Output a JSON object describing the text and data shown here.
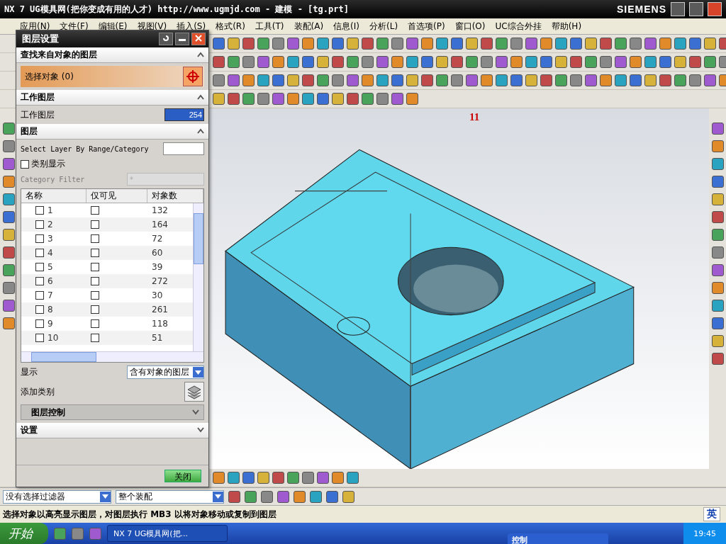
{
  "window": {
    "title": "NX 7 UG模具网(把你变成有用的人才) http://www.ugmjd.com - 建模 - [tg.prt]",
    "brand": "SIEMENS"
  },
  "menu": [
    "应用(N)",
    "文件(F)",
    "编辑(E)",
    "视图(V)",
    "插入(S)",
    "格式(R)",
    "工具(T)",
    "装配(A)",
    "信息(I)",
    "分析(L)",
    "首选项(P)",
    "窗口(O)",
    "UC综合外挂",
    "帮助(H)"
  ],
  "viewport": {
    "label": "11"
  },
  "dialog": {
    "title": "图层设置",
    "find_section": {
      "title": "查找来自对象的图层",
      "expanded": true,
      "select_label": "选择对象 (0)"
    },
    "work_section": {
      "title": "工作图层",
      "expanded": true,
      "label": "工作图层",
      "value": "254"
    },
    "layers_section": {
      "title": "图层",
      "expanded": true,
      "range_label": "Select Layer By Range/Category",
      "category_display": {
        "label": "类别显示",
        "checked": false
      },
      "category_filter": {
        "label": "Category Filter",
        "value": "*",
        "disabled": true
      },
      "columns": [
        "名称",
        "仅可见",
        "对象数"
      ],
      "rows": [
        {
          "name": "1",
          "checked": false,
          "visible_only": false,
          "count": "132"
        },
        {
          "name": "2",
          "checked": false,
          "visible_only": false,
          "count": "164"
        },
        {
          "name": "3",
          "checked": false,
          "visible_only": false,
          "count": "72"
        },
        {
          "name": "4",
          "checked": false,
          "visible_only": false,
          "count": "60"
        },
        {
          "name": "5",
          "checked": false,
          "visible_only": false,
          "count": "39"
        },
        {
          "name": "6",
          "checked": false,
          "visible_only": false,
          "count": "272"
        },
        {
          "name": "7",
          "checked": false,
          "visible_only": false,
          "count": "30"
        },
        {
          "name": "8",
          "checked": false,
          "visible_only": false,
          "count": "261"
        },
        {
          "name": "9",
          "checked": false,
          "visible_only": false,
          "count": "118"
        },
        {
          "name": "10",
          "checked": false,
          "visible_only": false,
          "count": "51"
        }
      ],
      "show_label": "显示",
      "show_value": "含有对象的图层",
      "add_category_label": "添加类别",
      "control": {
        "title": "图层控制",
        "expanded": false
      }
    },
    "settings_section": {
      "title": "设置",
      "expanded": false
    },
    "close_button": "关闭"
  },
  "filters": [
    "没有选择过滤器",
    "整个装配"
  ],
  "status_text": "选择对象以高亮显示图层，对图层执行 MB3 以将对象移动或复制到图层",
  "ime": "英",
  "taskbar": {
    "start": "开始",
    "tasks": [
      {
        "label": "NX 7 UG模具网(把...",
        "selected": true
      }
    ],
    "clock": "19:45",
    "popup": "控制"
  }
}
